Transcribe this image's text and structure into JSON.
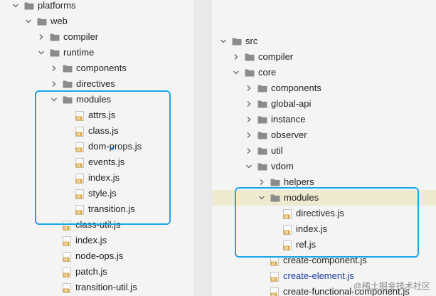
{
  "left_tree": [
    {
      "label": "platforms",
      "type": "folder",
      "expanded": true,
      "depth": 0
    },
    {
      "label": "web",
      "type": "folder",
      "expanded": true,
      "depth": 1
    },
    {
      "label": "compiler",
      "type": "folder",
      "expanded": false,
      "depth": 2
    },
    {
      "label": "runtime",
      "type": "folder",
      "expanded": true,
      "depth": 2
    },
    {
      "label": "components",
      "type": "folder",
      "expanded": false,
      "depth": 3
    },
    {
      "label": "directives",
      "type": "folder",
      "expanded": false,
      "depth": 3
    },
    {
      "label": "modules",
      "type": "folder",
      "expanded": true,
      "depth": 3
    },
    {
      "label": "attrs.js",
      "type": "js",
      "depth": 4
    },
    {
      "label": "class.js",
      "type": "js",
      "depth": 4
    },
    {
      "label": "dom-props.js",
      "type": "js",
      "depth": 4
    },
    {
      "label": "events.js",
      "type": "js",
      "depth": 4
    },
    {
      "label": "index.js",
      "type": "js",
      "depth": 4
    },
    {
      "label": "style.js",
      "type": "js",
      "depth": 4
    },
    {
      "label": "transition.js",
      "type": "js",
      "depth": 4
    },
    {
      "label": "class-util.js",
      "type": "js",
      "depth": 3
    },
    {
      "label": "index.js",
      "type": "js",
      "depth": 3
    },
    {
      "label": "node-ops.js",
      "type": "js",
      "depth": 3
    },
    {
      "label": "patch.js",
      "type": "js",
      "depth": 3
    },
    {
      "label": "transition-util.js",
      "type": "js",
      "depth": 3
    }
  ],
  "right_tree": [
    {
      "label": "src",
      "type": "folder",
      "expanded": true,
      "depth": 0
    },
    {
      "label": "compiler",
      "type": "folder",
      "expanded": false,
      "depth": 1
    },
    {
      "label": "core",
      "type": "folder",
      "expanded": true,
      "depth": 1
    },
    {
      "label": "components",
      "type": "folder",
      "expanded": false,
      "depth": 2
    },
    {
      "label": "global-api",
      "type": "folder",
      "expanded": false,
      "depth": 2
    },
    {
      "label": "instance",
      "type": "folder",
      "expanded": false,
      "depth": 2
    },
    {
      "label": "observer",
      "type": "folder",
      "expanded": false,
      "depth": 2
    },
    {
      "label": "util",
      "type": "folder",
      "expanded": false,
      "depth": 2
    },
    {
      "label": "vdom",
      "type": "folder",
      "expanded": true,
      "depth": 2
    },
    {
      "label": "helpers",
      "type": "folder",
      "expanded": false,
      "depth": 3
    },
    {
      "label": "modules",
      "type": "folder",
      "expanded": true,
      "depth": 3,
      "selected": true
    },
    {
      "label": "directives.js",
      "type": "js",
      "depth": 4
    },
    {
      "label": "index.js",
      "type": "js",
      "depth": 4
    },
    {
      "label": "ref.js",
      "type": "js",
      "depth": 4
    },
    {
      "label": "create-component.js",
      "type": "js",
      "depth": 3
    },
    {
      "label": "create-element.js",
      "type": "js",
      "depth": 3,
      "blue": true
    },
    {
      "label": "create-functional-component.js",
      "type": "js",
      "depth": 3
    }
  ],
  "watermark": "@稀土掘金技术社区",
  "colors": {
    "folder": "#8b8b8b",
    "js_icon_bg": "#d9a441",
    "highlight": "#1aa6e8",
    "selected_row": "#eeeacf",
    "blue_text": "#1b3f9e"
  }
}
